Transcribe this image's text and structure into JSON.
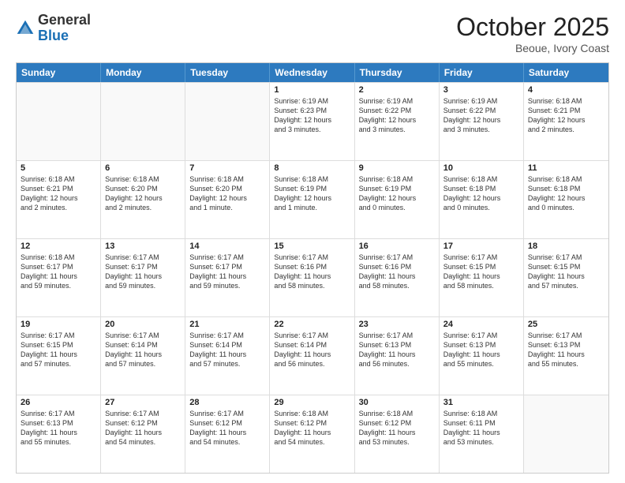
{
  "header": {
    "logo_general": "General",
    "logo_blue": "Blue",
    "month": "October 2025",
    "location": "Beoue, Ivory Coast"
  },
  "days_of_week": [
    "Sunday",
    "Monday",
    "Tuesday",
    "Wednesday",
    "Thursday",
    "Friday",
    "Saturday"
  ],
  "weeks": [
    [
      {
        "day": "",
        "lines": []
      },
      {
        "day": "",
        "lines": []
      },
      {
        "day": "",
        "lines": []
      },
      {
        "day": "1",
        "lines": [
          "Sunrise: 6:19 AM",
          "Sunset: 6:23 PM",
          "Daylight: 12 hours",
          "and 3 minutes."
        ]
      },
      {
        "day": "2",
        "lines": [
          "Sunrise: 6:19 AM",
          "Sunset: 6:22 PM",
          "Daylight: 12 hours",
          "and 3 minutes."
        ]
      },
      {
        "day": "3",
        "lines": [
          "Sunrise: 6:19 AM",
          "Sunset: 6:22 PM",
          "Daylight: 12 hours",
          "and 3 minutes."
        ]
      },
      {
        "day": "4",
        "lines": [
          "Sunrise: 6:18 AM",
          "Sunset: 6:21 PM",
          "Daylight: 12 hours",
          "and 2 minutes."
        ]
      }
    ],
    [
      {
        "day": "5",
        "lines": [
          "Sunrise: 6:18 AM",
          "Sunset: 6:21 PM",
          "Daylight: 12 hours",
          "and 2 minutes."
        ]
      },
      {
        "day": "6",
        "lines": [
          "Sunrise: 6:18 AM",
          "Sunset: 6:20 PM",
          "Daylight: 12 hours",
          "and 2 minutes."
        ]
      },
      {
        "day": "7",
        "lines": [
          "Sunrise: 6:18 AM",
          "Sunset: 6:20 PM",
          "Daylight: 12 hours",
          "and 1 minute."
        ]
      },
      {
        "day": "8",
        "lines": [
          "Sunrise: 6:18 AM",
          "Sunset: 6:19 PM",
          "Daylight: 12 hours",
          "and 1 minute."
        ]
      },
      {
        "day": "9",
        "lines": [
          "Sunrise: 6:18 AM",
          "Sunset: 6:19 PM",
          "Daylight: 12 hours",
          "and 0 minutes."
        ]
      },
      {
        "day": "10",
        "lines": [
          "Sunrise: 6:18 AM",
          "Sunset: 6:18 PM",
          "Daylight: 12 hours",
          "and 0 minutes."
        ]
      },
      {
        "day": "11",
        "lines": [
          "Sunrise: 6:18 AM",
          "Sunset: 6:18 PM",
          "Daylight: 12 hours",
          "and 0 minutes."
        ]
      }
    ],
    [
      {
        "day": "12",
        "lines": [
          "Sunrise: 6:18 AM",
          "Sunset: 6:17 PM",
          "Daylight: 11 hours",
          "and 59 minutes."
        ]
      },
      {
        "day": "13",
        "lines": [
          "Sunrise: 6:17 AM",
          "Sunset: 6:17 PM",
          "Daylight: 11 hours",
          "and 59 minutes."
        ]
      },
      {
        "day": "14",
        "lines": [
          "Sunrise: 6:17 AM",
          "Sunset: 6:17 PM",
          "Daylight: 11 hours",
          "and 59 minutes."
        ]
      },
      {
        "day": "15",
        "lines": [
          "Sunrise: 6:17 AM",
          "Sunset: 6:16 PM",
          "Daylight: 11 hours",
          "and 58 minutes."
        ]
      },
      {
        "day": "16",
        "lines": [
          "Sunrise: 6:17 AM",
          "Sunset: 6:16 PM",
          "Daylight: 11 hours",
          "and 58 minutes."
        ]
      },
      {
        "day": "17",
        "lines": [
          "Sunrise: 6:17 AM",
          "Sunset: 6:15 PM",
          "Daylight: 11 hours",
          "and 58 minutes."
        ]
      },
      {
        "day": "18",
        "lines": [
          "Sunrise: 6:17 AM",
          "Sunset: 6:15 PM",
          "Daylight: 11 hours",
          "and 57 minutes."
        ]
      }
    ],
    [
      {
        "day": "19",
        "lines": [
          "Sunrise: 6:17 AM",
          "Sunset: 6:15 PM",
          "Daylight: 11 hours",
          "and 57 minutes."
        ]
      },
      {
        "day": "20",
        "lines": [
          "Sunrise: 6:17 AM",
          "Sunset: 6:14 PM",
          "Daylight: 11 hours",
          "and 57 minutes."
        ]
      },
      {
        "day": "21",
        "lines": [
          "Sunrise: 6:17 AM",
          "Sunset: 6:14 PM",
          "Daylight: 11 hours",
          "and 57 minutes."
        ]
      },
      {
        "day": "22",
        "lines": [
          "Sunrise: 6:17 AM",
          "Sunset: 6:14 PM",
          "Daylight: 11 hours",
          "and 56 minutes."
        ]
      },
      {
        "day": "23",
        "lines": [
          "Sunrise: 6:17 AM",
          "Sunset: 6:13 PM",
          "Daylight: 11 hours",
          "and 56 minutes."
        ]
      },
      {
        "day": "24",
        "lines": [
          "Sunrise: 6:17 AM",
          "Sunset: 6:13 PM",
          "Daylight: 11 hours",
          "and 55 minutes."
        ]
      },
      {
        "day": "25",
        "lines": [
          "Sunrise: 6:17 AM",
          "Sunset: 6:13 PM",
          "Daylight: 11 hours",
          "and 55 minutes."
        ]
      }
    ],
    [
      {
        "day": "26",
        "lines": [
          "Sunrise: 6:17 AM",
          "Sunset: 6:13 PM",
          "Daylight: 11 hours",
          "and 55 minutes."
        ]
      },
      {
        "day": "27",
        "lines": [
          "Sunrise: 6:17 AM",
          "Sunset: 6:12 PM",
          "Daylight: 11 hours",
          "and 54 minutes."
        ]
      },
      {
        "day": "28",
        "lines": [
          "Sunrise: 6:17 AM",
          "Sunset: 6:12 PM",
          "Daylight: 11 hours",
          "and 54 minutes."
        ]
      },
      {
        "day": "29",
        "lines": [
          "Sunrise: 6:18 AM",
          "Sunset: 6:12 PM",
          "Daylight: 11 hours",
          "and 54 minutes."
        ]
      },
      {
        "day": "30",
        "lines": [
          "Sunrise: 6:18 AM",
          "Sunset: 6:12 PM",
          "Daylight: 11 hours",
          "and 53 minutes."
        ]
      },
      {
        "day": "31",
        "lines": [
          "Sunrise: 6:18 AM",
          "Sunset: 6:11 PM",
          "Daylight: 11 hours",
          "and 53 minutes."
        ]
      },
      {
        "day": "",
        "lines": []
      }
    ]
  ]
}
